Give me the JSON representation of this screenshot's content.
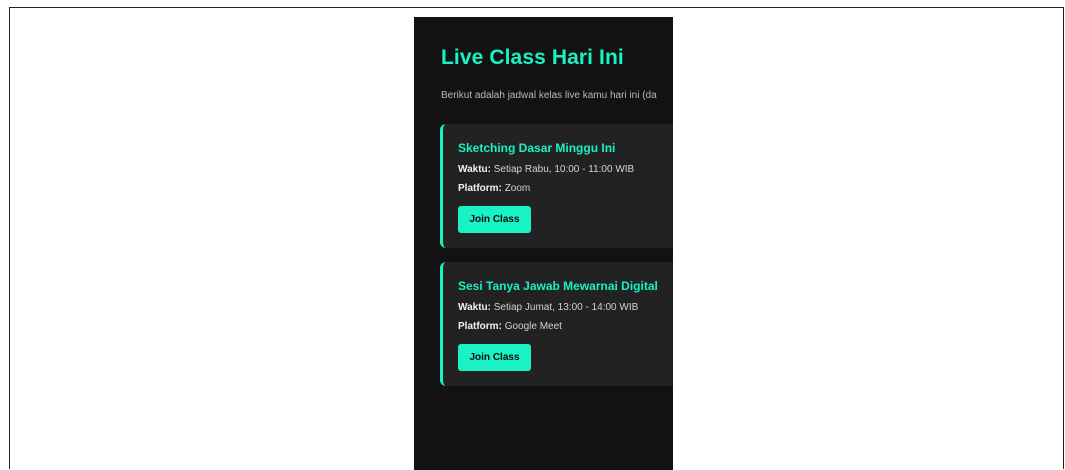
{
  "page": {
    "title": "Live Class Hari Ini",
    "subtitle": "Berikut adalah jadwal kelas live kamu hari ini (da"
  },
  "colors": {
    "accent": "#18f2c4",
    "background": "#121212",
    "card": "#222222"
  },
  "classes": [
    {
      "title": "Sketching Dasar Minggu Ini",
      "time_label": "Waktu:",
      "time_value": "Setiap Rabu, 10:00 - 11:00 WIB",
      "platform_label": "Platform:",
      "platform_value": "Zoom",
      "button_label": "Join Class"
    },
    {
      "title": "Sesi Tanya Jawab Mewarnai Digital",
      "time_label": "Waktu:",
      "time_value": "Setiap Jumat, 13:00 - 14:00 WIB",
      "platform_label": "Platform:",
      "platform_value": "Google Meet",
      "button_label": "Join Class"
    }
  ]
}
